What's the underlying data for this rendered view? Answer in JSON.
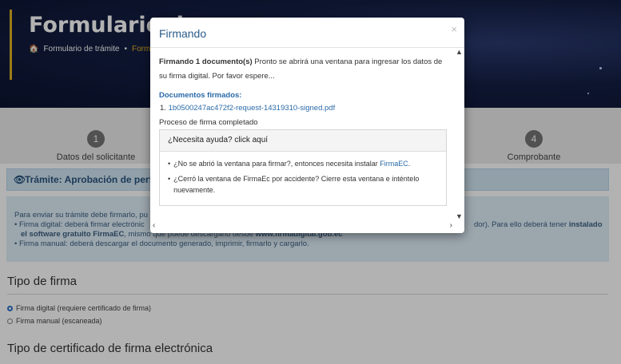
{
  "header": {
    "title": "Formulario de",
    "breadcrumb_home": "Formulario de trámite",
    "breadcrumb_current": "Formu"
  },
  "wizard": {
    "steps": [
      {
        "number": "1",
        "label": "Datos del solicitante"
      },
      {
        "number": "4",
        "label": "Comprobante"
      }
    ]
  },
  "section": {
    "title": "Trámite: Aprobación de perfo"
  },
  "info": {
    "line1": "Para enviar su trámite debe firmarlo, pu",
    "line2_a": "• Firma digital: deberá firmar electrónic",
    "line2_b": "dor). Para ello deberá tener",
    "line2_bold": "instalado",
    "line3_bold_a": "el software gratuito FirmaEC",
    "line3_mid": ", mismo que puede descargarlo desde",
    "line3_bold_b": "www.firmadigital.gob.ec",
    "line4": "• Firma manual: deberá descargar el documento generado, imprimir, firmarlo y cargarlo."
  },
  "tipo_firma": {
    "heading": "Tipo de firma",
    "option_digital": "Firma digital (requiere certificado de firma)",
    "option_manual": "Firma manual (escaneada)"
  },
  "tipo_certificado": {
    "heading": "Tipo de certificado de firma electrónica"
  },
  "modal": {
    "title": "Firmando",
    "close": "×",
    "intro_bold": "Firmando 1 documento(s)",
    "intro_text": " Pronto se abrirá una ventana para ingresar los datos de su firma digital. Por favor espere...",
    "docs_label": "Documentos firmados:",
    "doc_index": "1.",
    "doc_name": "1b0500247ac472f2-request-14319310-signed.pdf",
    "done": "Proceso de firma completado",
    "help_title": "¿Necesita ayuda? click aquí",
    "help_1_text": "¿No se abrió la ventana para firmar?, entonces necesita instalar ",
    "help_1_link": "FirmaEC",
    "help_1_end": ".",
    "help_2_text": "¿Cerró la ventana de FirmaEc por accidente? Cierre esta ventana e inténtelo nuevamente."
  }
}
